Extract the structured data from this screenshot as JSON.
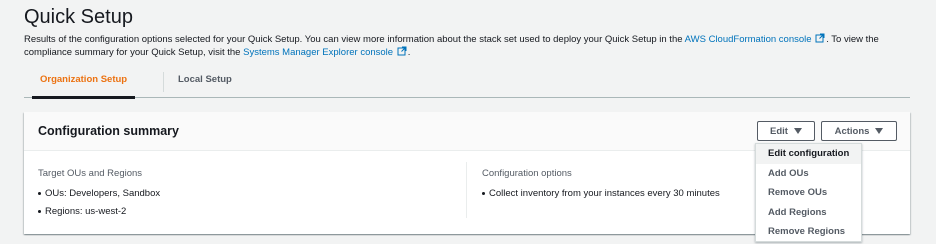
{
  "page": {
    "title": "Quick Setup",
    "intro": {
      "part1": "Results of the configuration options selected for your Quick Setup. You can view more information about the stack set used to deploy your Quick Setup in the ",
      "link1": "AWS CloudFormation console",
      "part2": ". To view the compliance summary for your Quick Setup, visit the ",
      "link2": "Systems Manager Explorer console",
      "part3": "."
    }
  },
  "tabs": [
    {
      "label": "Organization Setup",
      "active": true
    },
    {
      "label": "Local Setup",
      "active": false
    }
  ],
  "card": {
    "title": "Configuration summary",
    "edit_label": "Edit",
    "actions_label": "Actions",
    "left": {
      "label": "Target OUs and Regions",
      "items": [
        "OUs: Developers, Sandbox",
        "Regions: us-west-2"
      ]
    },
    "right": {
      "label": "Configuration options",
      "items": [
        "Collect inventory from your instances every 30 minutes"
      ]
    }
  },
  "edit_menu": {
    "items": [
      "Edit configuration",
      "Add OUs",
      "Remove OUs",
      "Add Regions",
      "Remove Regions"
    ],
    "highlighted": "Edit configuration"
  },
  "icons": {
    "external_link": "external-link-icon",
    "caret_down": "caret-down-icon"
  },
  "colors": {
    "accent": "#ec7211",
    "link": "#0073bb",
    "text": "#16191f",
    "secondary_text": "#545b64",
    "background": "#f2f3f3"
  }
}
